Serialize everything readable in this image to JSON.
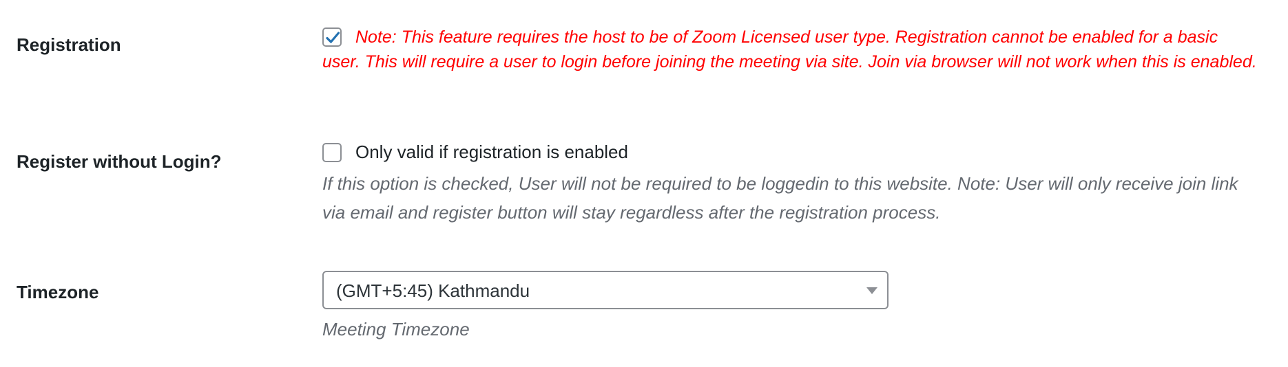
{
  "registration": {
    "label": "Registration",
    "checked": true,
    "note": "Note: This feature requires the host to be of Zoom Licensed user type. Registration cannot be enabled for a basic user. This will require a user to login before joining the meeting via site. Join via browser will not work when this is enabled."
  },
  "register_without_login": {
    "label": "Register without Login?",
    "checked": false,
    "checkbox_label": "Only valid if registration is enabled",
    "description": "If this option is checked, User will not be required to be loggedin to this website. Note: User will only receive join link via email and register button will stay regardless after the registration process."
  },
  "timezone": {
    "label": "Timezone",
    "selected": "(GMT+5:45) Kathmandu",
    "description": "Meeting Timezone"
  },
  "colors": {
    "check_mark": "#2271b1",
    "note_red": "#ff0000",
    "description_gray": "#646970"
  }
}
